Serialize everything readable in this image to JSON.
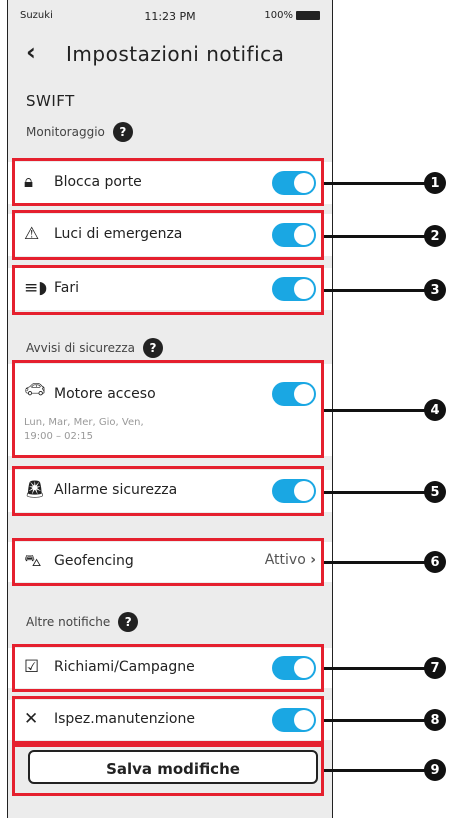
{
  "status_bar": {
    "carrier": "Suzuki",
    "time": "11:23 PM",
    "battery": "100%"
  },
  "header": {
    "back_icon": "chevron-left-icon",
    "title": "Impostazioni notifica"
  },
  "vehicle": "SWIFT",
  "sections": {
    "monitoraggio": "Monitoraggio",
    "avvisi": "Avvisi di sicurezza",
    "altre": "Altre notifiche"
  },
  "help_glyph": "?",
  "rows": {
    "blocca": {
      "label": "Blocca porte",
      "icon": "lock-icon",
      "enabled": true
    },
    "luci": {
      "label": "Luci di emergenza",
      "icon": "hazard-icon",
      "enabled": true
    },
    "fari": {
      "label": "Fari",
      "icon": "headlight-icon",
      "enabled": true
    },
    "motore": {
      "label": "Motore acceso",
      "icon": "engine-icon",
      "enabled": true,
      "schedule": "Lun, Mar, Mer, Gio, Ven,\n19:00 – 02:15"
    },
    "allarme": {
      "label": "Allarme sicurezza",
      "icon": "alarm-car-icon",
      "enabled": true
    },
    "geofencing": {
      "label": "Geofencing",
      "icon": "geofence-car-icon",
      "status": "Attivo"
    },
    "richiami": {
      "label": "Richiami/Campagne",
      "icon": "recall-icon",
      "enabled": true
    },
    "ispez": {
      "label": "Ispez.manutenzione",
      "icon": "tools-icon",
      "enabled": true
    }
  },
  "save_button": "Salva modifiche",
  "callouts": [
    "1",
    "2",
    "3",
    "4",
    "5",
    "6",
    "7",
    "8",
    "9"
  ],
  "colors": {
    "toggle_on": "#1aa7e3",
    "highlight": "#e5202e",
    "badge": "#111111"
  }
}
